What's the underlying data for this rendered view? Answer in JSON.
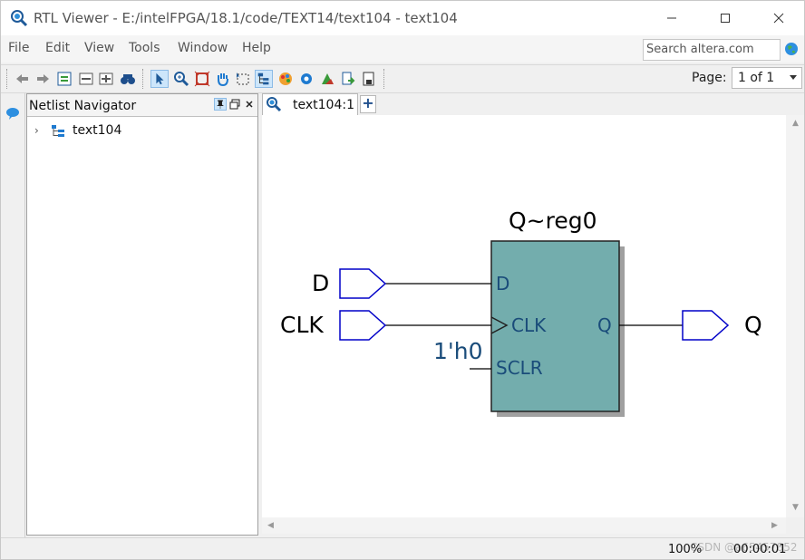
{
  "window": {
    "title": "RTL Viewer - E:/intelFPGA/18.1/code/TEXT14/text104 - text104",
    "controls": [
      "minimize",
      "maximize",
      "close"
    ]
  },
  "menubar": {
    "items": [
      "File",
      "Edit",
      "View",
      "Tools",
      "Window",
      "Help"
    ],
    "search_value": "Search altera.com"
  },
  "toolbar": {
    "icons": [
      "back-icon",
      "forward-icon",
      "refresh-icon",
      "collapse-icon",
      "expand-icon",
      "find-icon",
      "select-pointer-icon",
      "zoom-icon",
      "fit-icon",
      "hand-pan-icon",
      "select-region-icon",
      "hierarchy-icon",
      "color-icon",
      "settings-icon",
      "filter-icon",
      "export-icon",
      "print-icon"
    ],
    "page_label": "Page:",
    "page_value": "1 of 1"
  },
  "navigator": {
    "title": "Netlist Navigator",
    "tree": [
      {
        "label": "text104",
        "expanded": false
      }
    ]
  },
  "tabs": [
    {
      "label": "text104:1"
    }
  ],
  "schematic": {
    "register_name": "Q~reg0",
    "inputs": [
      "D",
      "CLK"
    ],
    "output": "Q",
    "ports_left": [
      "D",
      "CLK",
      "SCLR"
    ],
    "port_right": "Q",
    "constant": "1'h0",
    "colors": {
      "block_fill": "#73ADAD",
      "port_text": "#1A4C7A",
      "io_stroke": "#0000C8",
      "wire": "#000000",
      "shadow": "#A0A0A0"
    }
  },
  "status": {
    "zoom": "100%",
    "time": "00:00:01",
    "watermark": "CSDN @a65457852"
  }
}
